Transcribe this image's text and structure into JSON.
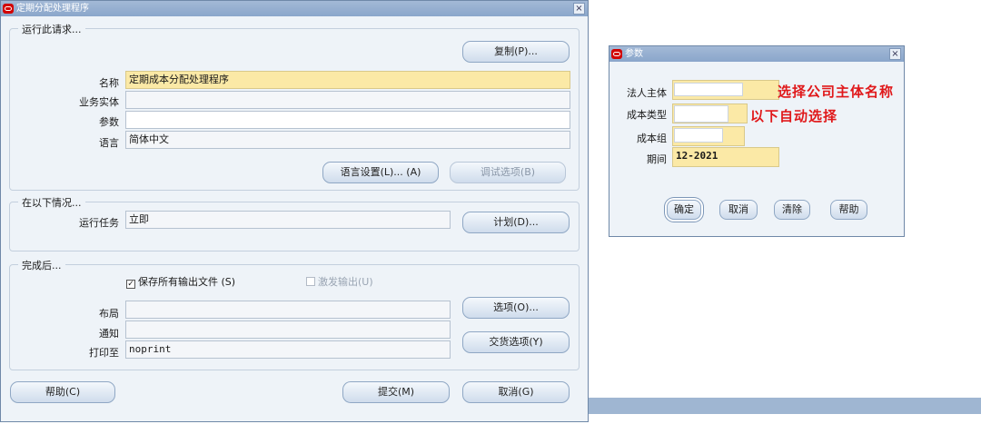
{
  "main_window": {
    "title": "定期分配处理程序",
    "close_icon": "×",
    "group_run": {
      "title": "运行此请求...",
      "copy_button": "复制(P)...",
      "name_label": "名称",
      "name_value": "定期成本分配处理程序",
      "org_label": "业务实体",
      "org_value": "",
      "params_label": "参数",
      "params_value": "",
      "lang_label": "语言",
      "lang_value": "简体中文",
      "lang_settings_button": "语言设置(L)... (A)",
      "debug_button": "调试选项(B)"
    },
    "group_when": {
      "title": "在以下情况...",
      "run_task_label": "运行任务",
      "run_task_value": "立即",
      "schedule_button": "计划(D)..."
    },
    "group_after": {
      "title": "完成后...",
      "save_output_label": "保存所有输出文件 (S)",
      "save_output_checked": true,
      "burst_label": "激发输出(U)",
      "burst_checked": false,
      "layout_label": "布局",
      "layout_value": "",
      "notify_label": "通知",
      "notify_value": "",
      "print_label": "打印至",
      "print_value": "noprint",
      "options_button": "选项(O)...",
      "delivery_button": "交货选项(Y)"
    },
    "help_button": "帮助(C)",
    "submit_button": "提交(M)",
    "cancel_button": "取消(G)"
  },
  "param_window": {
    "title": "参数",
    "close_icon": "×",
    "entity_label": "法人主体",
    "cost_type_label": "成本类型",
    "cost_group_label": "成本组",
    "period_label": "期间",
    "period_value": "12-2021",
    "annotation_1": "选择公司主体名称",
    "annotation_2": "以下自动选择",
    "ok_button": "确定",
    "cancel_button": "取消",
    "clear_button": "清除",
    "help_button": "帮助"
  },
  "colors": {
    "titlebar": "#8aa6cb",
    "window_bg": "#eef3f8",
    "required_field": "#fbe9a6",
    "annotation": "#e0181a",
    "oracle_icon": "#d20000"
  }
}
